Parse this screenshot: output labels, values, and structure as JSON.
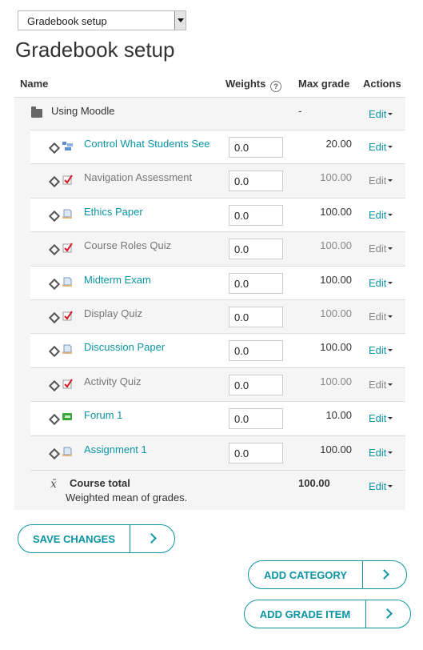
{
  "selector": {
    "value": "Gradebook setup"
  },
  "page_title": "Gradebook setup",
  "table": {
    "headers": {
      "name": "Name",
      "weights": "Weights",
      "max_grade": "Max grade",
      "actions": "Actions"
    },
    "category": {
      "name": "Using Moodle",
      "max_grade": "-",
      "action": "Edit"
    },
    "items": [
      {
        "name": "Control What Students See",
        "weight": "0.0",
        "max_grade": "20.00",
        "action": "Edit",
        "dimmed": false,
        "icon": "lesson-icon"
      },
      {
        "name": "Navigation Assessment",
        "weight": "0.0",
        "max_grade": "100.00",
        "action": "Edit",
        "dimmed": true,
        "icon": "quiz-icon"
      },
      {
        "name": "Ethics Paper",
        "weight": "0.0",
        "max_grade": "100.00",
        "action": "Edit",
        "dimmed": false,
        "icon": "assignment-icon"
      },
      {
        "name": "Course Roles Quiz",
        "weight": "0.0",
        "max_grade": "100.00",
        "action": "Edit",
        "dimmed": true,
        "icon": "quiz-icon"
      },
      {
        "name": "Midterm Exam",
        "weight": "0.0",
        "max_grade": "100.00",
        "action": "Edit",
        "dimmed": false,
        "icon": "assignment-icon"
      },
      {
        "name": "Display Quiz",
        "weight": "0.0",
        "max_grade": "100.00",
        "action": "Edit",
        "dimmed": true,
        "icon": "quiz-icon"
      },
      {
        "name": "Discussion Paper",
        "weight": "0.0",
        "max_grade": "100.00",
        "action": "Edit",
        "dimmed": false,
        "icon": "assignment-icon"
      },
      {
        "name": "Activity Quiz",
        "weight": "0.0",
        "max_grade": "100.00",
        "action": "Edit",
        "dimmed": true,
        "icon": "quiz-icon"
      },
      {
        "name": "Forum 1",
        "weight": "0.0",
        "max_grade": "10.00",
        "action": "Edit",
        "dimmed": false,
        "icon": "forum-icon"
      },
      {
        "name": "Assignment 1",
        "weight": "0.0",
        "max_grade": "100.00",
        "action": "Edit",
        "dimmed": false,
        "icon": "assignment-icon"
      }
    ],
    "total": {
      "label": "Course total",
      "subtitle": "Weighted mean of grades.",
      "max_grade": "100.00",
      "action": "Edit"
    }
  },
  "buttons": {
    "save": "SAVE CHANGES",
    "add_category": "ADD CATEGORY",
    "add_grade_item": "ADD GRADE ITEM"
  },
  "colors": {
    "accent": "#0b94a2",
    "dim_text": "#888888",
    "row_grey": "#f5f5f5"
  }
}
